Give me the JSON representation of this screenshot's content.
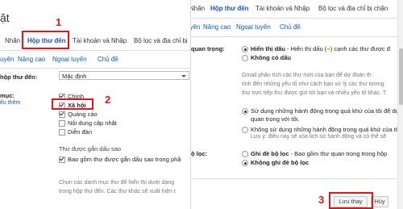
{
  "left": {
    "title_fragment": "ặt",
    "tabs": [
      "Nhãn",
      "Hộp thư đến",
      "Tài khoản và Nhập",
      "Bộ lọc và địa chỉ bị"
    ],
    "subtabs": [
      "uyên",
      "Nâng cao",
      "Ngoại tuyến",
      "Chủ đề"
    ],
    "inbox_type_label": "hộp thư đến:",
    "inbox_type_value": "Mặc định",
    "categories_label": "mục:",
    "categories_link": "êu thêm",
    "categories": [
      {
        "label": "Chính",
        "checked": true
      },
      {
        "label": "Xã hội",
        "checked": true
      },
      {
        "label": "Quảng cáo",
        "checked": true
      },
      {
        "label": "Nội dung cập nhật",
        "checked": false
      },
      {
        "label": "Diễn đàn",
        "checked": false
      }
    ],
    "starred_heading": "Thư được gắn dấu sao",
    "starred_option": "Bao gồm thư được gắn dấu sao trong phầ",
    "desc1": "Chọn các danh mục thư để hiển thị dưới dạng",
    "desc2": "trong hộp thư đến. Các thư khác sẽ xuất hiện t"
  },
  "right": {
    "tabs": [
      "Nhãn",
      "Hộp thư đến",
      "Tài khoản và Nhập",
      "Bộ lọc và địa chỉ bị chặn"
    ],
    "subtabs": [
      "uyên",
      "Nâng cao",
      "Ngoại tuyến",
      "Chủ đề"
    ],
    "important_label": "quan trọng:",
    "markers": [
      {
        "bold": "Hiển thị dấu",
        "rest": " - Hiển thị dấu (",
        "after": ") cạnh các thư được đ",
        "on": true
      },
      {
        "bold": "Không có dấu",
        "rest": "",
        "after": "",
        "on": false
      }
    ],
    "gmail_desc": [
      "Gmail phân tích các thư mới của bạn để dự đoán th",
      "tính đến những yếu tố như cách bạn xử lý các thư tương",
      "thư trực tiếp thư được gửi tới bạn và nhiều yếu tố khác. T"
    ],
    "actions": [
      {
        "lines": [
          "Sử dụng những hành động trong quá khứ của tôi để dự",
          "quan trọng với tôi."
        ],
        "on": true
      },
      {
        "lines": [
          "Không sử dụng những hành động trong quá khứ của tôi",
          "Lưu ý: điều này sẽ xóa lịch sử hành động và có thể sẽ"
        ],
        "on": false
      }
    ],
    "override_label": "ộ lọc:",
    "overrides": [
      {
        "bold": "Ghi đè bộ lọc",
        "rest": " - Bao gồm thư quan trọng trong hộp",
        "on": false
      },
      {
        "bold": "Không ghi đè bộ lọc",
        "rest": "",
        "on": true
      }
    ],
    "save_label": "Lưu thay đổi",
    "cancel_label": "Hủy"
  },
  "steps": [
    "1",
    "2",
    "3"
  ],
  "colors": {
    "link": "#1155cc",
    "annotation": "#e0161b",
    "star": "#f5c518"
  }
}
